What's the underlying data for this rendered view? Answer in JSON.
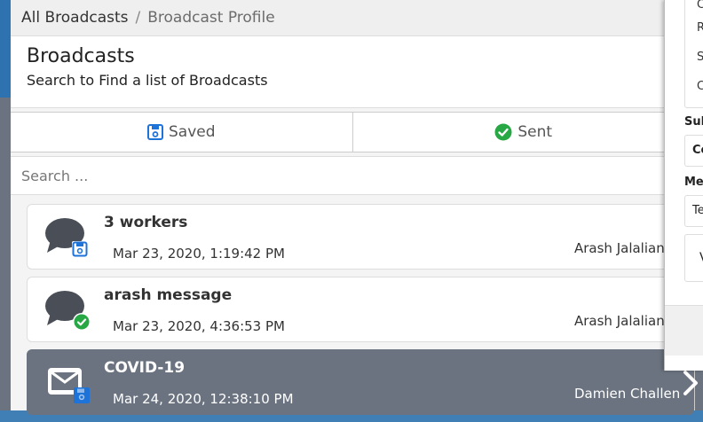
{
  "breadcrumb": {
    "root": "All Broadcasts",
    "separator": "/",
    "current": "Broadcast Profile"
  },
  "header": {
    "title": "Broadcasts",
    "subtitle": "Search to Find a list of Broadcasts"
  },
  "tabs": [
    {
      "label": "Saved",
      "icon": "floppy-disk-icon"
    },
    {
      "label": "Sent",
      "icon": "check-circle-icon"
    }
  ],
  "search": {
    "placeholder": "Search ...",
    "value": ""
  },
  "broadcasts": [
    {
      "title": "3 workers",
      "date": "Mar 23, 2020, 1:19:42 PM",
      "author": "Arash Jalalian",
      "icon": "chat-bubble-icon",
      "badge": "saved-badge-icon"
    },
    {
      "title": "arash message",
      "date": "Mar 23, 2020, 4:36:53 PM",
      "author": "Arash Jalalian",
      "icon": "chat-bubble-icon",
      "badge": "sent-badge-icon"
    },
    {
      "title": "COVID-19",
      "date": "Mar 24, 2020, 12:38:10 PM",
      "author": "Damien Challen",
      "icon": "envelope-icon",
      "badge": "saved-badge-icon"
    }
  ],
  "side_panel": {
    "letters": [
      "C",
      "R",
      "S",
      "C"
    ],
    "subject_label": "Sul",
    "subject_value": "Co",
    "message_label": "Me",
    "message_value": "Te",
    "body_letter": "V"
  },
  "colors": {
    "accent_blue": "#2e73b0",
    "sent_green": "#28a745",
    "saved_blue": "#1e73d8",
    "active_row": "#6b7380"
  }
}
